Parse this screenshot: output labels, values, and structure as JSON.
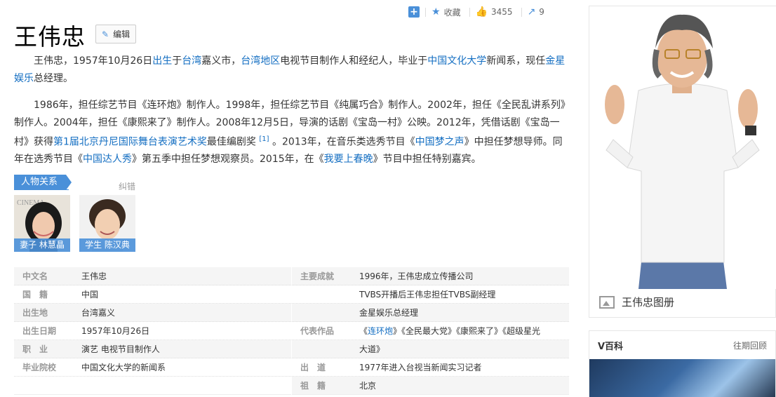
{
  "actions": {
    "favorite": "收藏",
    "likes": "3455",
    "shares": "9"
  },
  "title": "王伟忠",
  "edit_label": "编辑",
  "para1": {
    "t1": "王伟忠，1957年10月26日",
    "l1": "出生",
    "t2": "于",
    "l2": "台湾",
    "t3": "嘉义市，",
    "l3": "台湾地区",
    "t4": "电视节目制作人和经纪人，毕业于",
    "l4": "中国文化大学",
    "t5": "新闻系，现任",
    "l5": "金星娱乐",
    "t6": "总经理。"
  },
  "para2": {
    "t1": "1986年，担任综艺节目《连环炮》制作人。1998年，担任综艺节目《纯属巧合》制作人。2002年，担任《全民乱讲系列》制作人。2004年，担任《康熙来了》制作人。2008年12月5日，导演的话剧《宝岛一村》公映。2012年，凭借话剧《宝岛一村》获得",
    "l1": "第1届北京丹尼国际舞台表演艺术奖",
    "t2": "最佳编剧奖",
    "ref": "[1]",
    "t3": "。2013年，在音乐类选秀节目《",
    "l2": "中国梦之声",
    "t4": "》中担任梦想导师。同年在选秀节目《",
    "l3": "中国达人秀",
    "t5": "》第五季中担任梦想观察员。2015年，在《",
    "l4": "我要上春晚",
    "t6": "》节目中担任特别嘉宾。"
  },
  "relations": {
    "tag": "人物关系",
    "correct": "纠错",
    "people": [
      {
        "caption": "妻子 林慧晶"
      },
      {
        "caption": "学生 陈汉典"
      }
    ]
  },
  "info_left": [
    {
      "k": "中文名",
      "v": "王伟忠"
    },
    {
      "k": "国　籍",
      "v": "中国"
    },
    {
      "k": "出生地",
      "v": "台湾嘉义"
    },
    {
      "k": "出生日期",
      "v": "1957年10月26日"
    },
    {
      "k": "职　业",
      "v": "演艺 电视节目制作人"
    },
    {
      "k": "毕业院校",
      "v": "中国文化大学的新闻系"
    }
  ],
  "info_right": {
    "achievement_k": "主要成就",
    "achievement_1": "1996年，王伟忠成立传播公司",
    "achievement_2": "TVBS开播后王伟忠担任TVBS副经理",
    "achievement_3": "金星娱乐总经理",
    "works_k": "代表作品",
    "works_q1": "《",
    "works_link": "连环炮",
    "works_rest": "》《全民最大党》《康熙来了》《超级星光",
    "works_line2": "大道》",
    "debut_k": "出　道",
    "debut_v": "1977年进入台视当新闻实习记者",
    "origin_k": "祖　籍",
    "origin_v": "北京"
  },
  "sidebar": {
    "album_label": "王伟忠图册",
    "v_title": "V百科",
    "v_more": "往期回顾"
  },
  "colors": {
    "link": "#136ec2",
    "accent": "#4a90d9"
  }
}
